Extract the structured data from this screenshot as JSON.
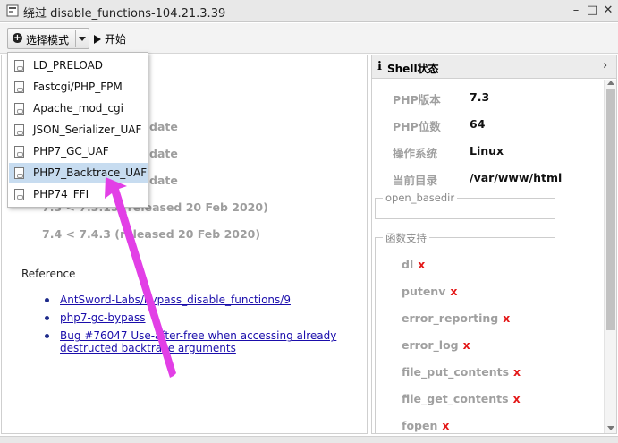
{
  "window": {
    "title": "绕过 disable_functions-104.21.3.39",
    "minimize": "–",
    "maximize": "□",
    "close": "✕"
  },
  "toolbar": {
    "mode_label": "选择模式",
    "start_label": "开始"
  },
  "dropdown": {
    "items": [
      {
        "label": "LD_PRELOAD"
      },
      {
        "label": "Fastcgi/PHP_FPM"
      },
      {
        "label": "Apache_mod_cgi"
      },
      {
        "label": "JSON_Serializer_UAF"
      },
      {
        "label": "PHP7_GC_UAF"
      },
      {
        "label": "PHP7_Backtrace_UAF"
      },
      {
        "label": "PHP74_FFI"
      }
    ],
    "selected": "PHP7_Backtrace_UAF"
  },
  "content": {
    "partial_lines": [
      "date",
      "date",
      "date"
    ],
    "versions": [
      "7.3 < 7.3.15 (released 20 Feb 2020)",
      "7.4 < 7.4.3 (released 20 Feb 2020)"
    ],
    "reference_heading": "Reference",
    "references": [
      {
        "text": "AntSword-Labs/bypass_disable_functions/9"
      },
      {
        "text": "php7-gc-bypass"
      },
      {
        "text": "Bug #76047 Use-after-free when accessing already destructed backtrace arguments"
      }
    ]
  },
  "shell": {
    "info_icon": "i",
    "title": "Shell状态",
    "rows": [
      {
        "label": "PHP版本",
        "value": "7.3"
      },
      {
        "label": "PHP位数",
        "value": "64"
      },
      {
        "label": "操作系统",
        "value": "Linux"
      },
      {
        "label": "当前目录",
        "value": "/var/www/html"
      }
    ],
    "open_basedir_legend": "open_basedir",
    "open_basedir_value": "",
    "functions_legend": "函数支持",
    "functions": [
      {
        "name": "dl",
        "status": "x"
      },
      {
        "name": "putenv",
        "status": "x"
      },
      {
        "name": "error_reporting",
        "status": "x"
      },
      {
        "name": "error_log",
        "status": "x"
      },
      {
        "name": "file_put_contents",
        "status": "x"
      },
      {
        "name": "file_get_contents",
        "status": "x"
      },
      {
        "name": "fopen",
        "status": "x"
      }
    ]
  },
  "colors": {
    "highlight": "#c7dcf0",
    "arrow": "#e23fe6",
    "unsupported": "#e41a1a",
    "link": "#1a0dab"
  }
}
